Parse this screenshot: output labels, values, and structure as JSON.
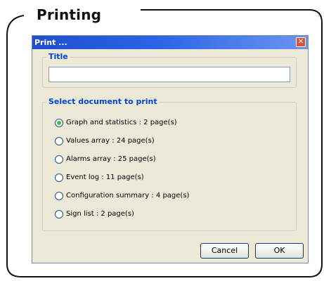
{
  "section_heading": "Printing",
  "dialog": {
    "title": "Print ...",
    "close_glyph": "✕",
    "title_group": {
      "legend": "Title",
      "value": "",
      "placeholder": ""
    },
    "document_group": {
      "legend": "Select document to print",
      "options": [
        {
          "label": "Graph and statistics : 2 page(s)",
          "checked": true
        },
        {
          "label": "Values array : 24 page(s)",
          "checked": false
        },
        {
          "label": "Alarms array : 25 page(s)",
          "checked": false
        },
        {
          "label": "Event log : 11 page(s)",
          "checked": false
        },
        {
          "label": "Configuration summary : 4 page(s)",
          "checked": false
        },
        {
          "label": "Sign list : 2 page(s)",
          "checked": false
        }
      ]
    },
    "buttons": {
      "cancel": "Cancel",
      "ok": "OK"
    }
  },
  "colors": {
    "titlebar": "#2a63e6",
    "dialog_bg": "#ece9d8",
    "legend_text": "#0046d5",
    "radio_selected": "#3fbd3f"
  }
}
